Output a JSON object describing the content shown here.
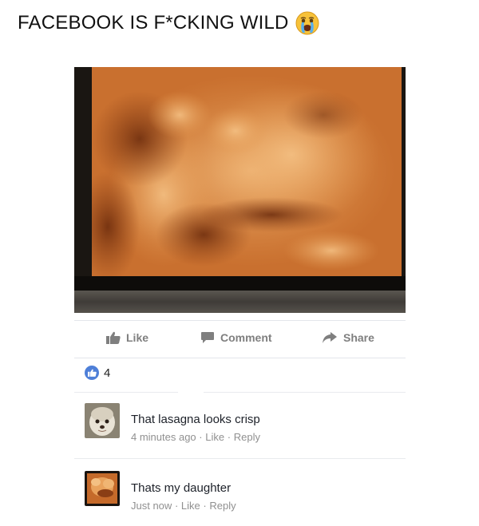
{
  "caption": {
    "text": "FACEBOOK IS F*CKING WILD"
  },
  "post": {
    "actions": {
      "like_label": "Like",
      "comment_label": "Comment",
      "share_label": "Share"
    },
    "reaction_count": "4"
  },
  "comments": [
    {
      "text": "That lasagna looks crisp",
      "time": "4 minutes ago",
      "like_label": "Like",
      "reply_label": "Reply",
      "separator": "·"
    },
    {
      "text": "Thats my daughter",
      "time": "Just now",
      "like_label": "Like",
      "reply_label": "Reply",
      "separator": "·"
    }
  ],
  "colors": {
    "like_badge": "#4e7fd8",
    "action_gray": "#7f7f7f",
    "meta_gray": "#909090"
  },
  "icons": [
    "crying-face-icon",
    "thumbs-up-icon",
    "comment-bubble-icon",
    "share-arrow-icon"
  ]
}
